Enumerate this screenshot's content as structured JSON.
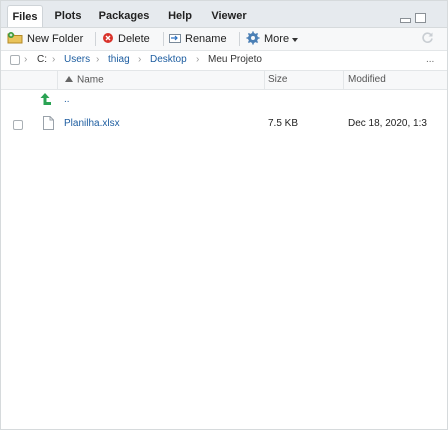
{
  "tabs": [
    "Files",
    "Plots",
    "Packages",
    "Help",
    "Viewer"
  ],
  "toolbar": {
    "new_folder": "New Folder",
    "delete": "Delete",
    "rename": "Rename",
    "more": "More"
  },
  "breadcrumb": [
    "C:",
    "Users",
    "thiag",
    "Desktop",
    "Meu Projeto"
  ],
  "more_path": "...",
  "columns": {
    "name": "Name",
    "size": "Size",
    "modified": "Modified"
  },
  "parent_dir": "..",
  "files": [
    {
      "name": "Planilha.xlsx",
      "size": "7.5 KB",
      "modified": "Dec 18, 2020, 1:3"
    }
  ],
  "colors": {
    "accent": "#1d5da0",
    "up_arrow": "#2aa353",
    "tab_bg": "#e6eaee"
  }
}
